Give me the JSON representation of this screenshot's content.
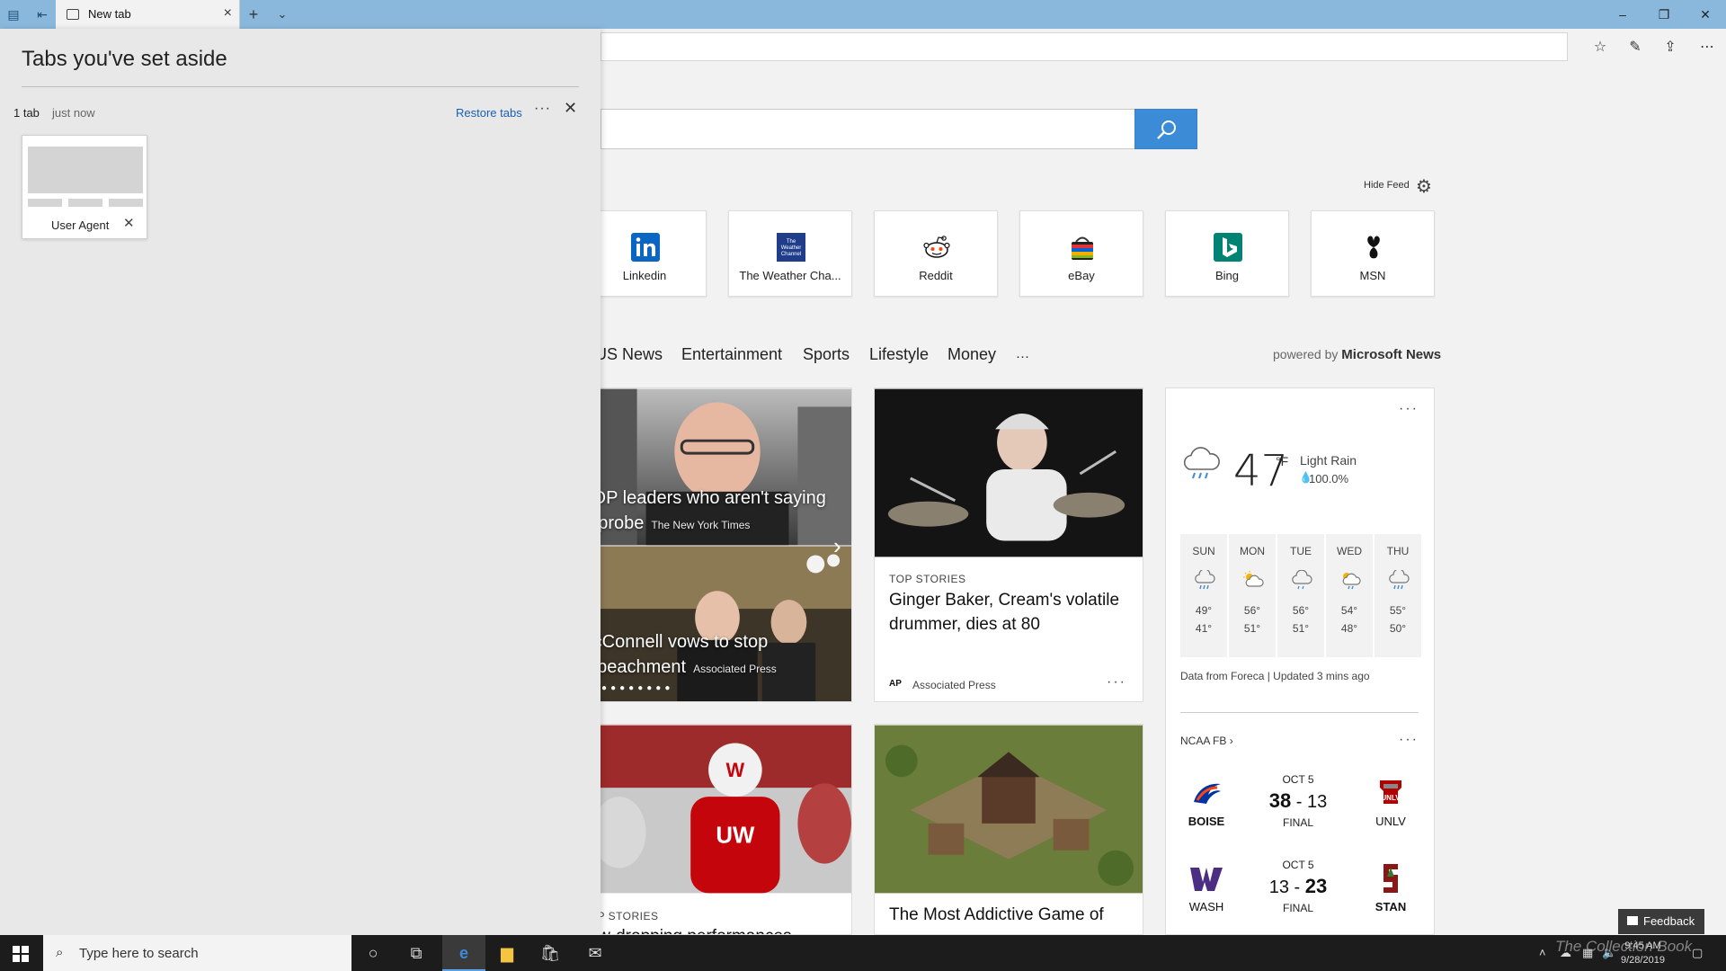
{
  "browser": {
    "tab_title": "New tab",
    "window_controls": {
      "minimize": "–",
      "restore": "❐",
      "close": "✕"
    }
  },
  "setaside": {
    "title": "Tabs you've set aside",
    "group_count": "1 tab",
    "group_time": "just now",
    "restore_label": "Restore tabs",
    "tab_label": "User Agent"
  },
  "page": {
    "hide_feed": "Hide Feed",
    "tiles": [
      {
        "label": "Linkedin",
        "icon": "linkedin-icon",
        "color": "#0a66c2"
      },
      {
        "label": "The Weather Cha...",
        "icon": "weather-channel-icon",
        "color": "#1f3d8a"
      },
      {
        "label": "Reddit",
        "icon": "reddit-icon",
        "color": "#ff4500"
      },
      {
        "label": "eBay",
        "icon": "ebay-icon",
        "color": "#e53238"
      },
      {
        "label": "Bing",
        "icon": "bing-icon",
        "color": "#008373"
      },
      {
        "label": "MSN",
        "icon": "msn-icon",
        "color": "#111111"
      }
    ],
    "categories": [
      "US News",
      "Entertainment",
      "Sports",
      "Lifestyle",
      "Money",
      "···"
    ],
    "powered_prefix": "powered by",
    "powered_brand": "Microsoft News"
  },
  "feed": {
    "carousel": {
      "cap1_line1": "GOP leaders who aren't saying",
      "cap1_line2": "to probe",
      "cap1_source": "The New York Times",
      "cap2_line1": "McConnell vows to stop",
      "cap2_line2": "impeachment",
      "cap2_source": "Associated Press"
    },
    "story1": {
      "kicker": "TOP STORIES",
      "title": "Ginger Baker, Cream's volatile drummer, dies at 80",
      "source_logo": "AP",
      "source": "Associated Press"
    },
    "story3": {
      "kicker": "TOP STORIES",
      "title": "Jaw-dropping performances"
    },
    "story4": {
      "title": "The Most Addictive Game of"
    }
  },
  "weather": {
    "temp": "47",
    "unit": "°F",
    "condition": "Light Rain",
    "precip": "100.0%",
    "forecast": [
      {
        "day": "SUN",
        "hi": "49°",
        "lo": "41°",
        "icon": "rain-cloud-icon"
      },
      {
        "day": "MON",
        "hi": "56°",
        "lo": "51°",
        "icon": "partly-sunny-icon"
      },
      {
        "day": "TUE",
        "hi": "56°",
        "lo": "51°",
        "icon": "cloud-icon"
      },
      {
        "day": "WED",
        "hi": "54°",
        "lo": "48°",
        "icon": "sun-rain-icon"
      },
      {
        "day": "THU",
        "hi": "55°",
        "lo": "50°",
        "icon": "rain-cloud-icon"
      }
    ],
    "footer": "Data from Foreca | Updated 3 mins ago"
  },
  "sports": {
    "league": "NCAA FB",
    "games": [
      {
        "home": "BOISE",
        "away": "UNLV",
        "date": "OCT 5",
        "home_score": "38",
        "away_score": "13",
        "status": "FINAL"
      },
      {
        "home": "WASH",
        "away": "STAN",
        "date": "OCT 5",
        "home_score": "13",
        "away_score": "23",
        "status": "FINAL"
      }
    ]
  },
  "feedback_label": "Feedback",
  "taskbar": {
    "search_placeholder": "Type here to search",
    "time": "9:45 AM",
    "date": "9/28/2019"
  },
  "watermark": "The Collection Book"
}
